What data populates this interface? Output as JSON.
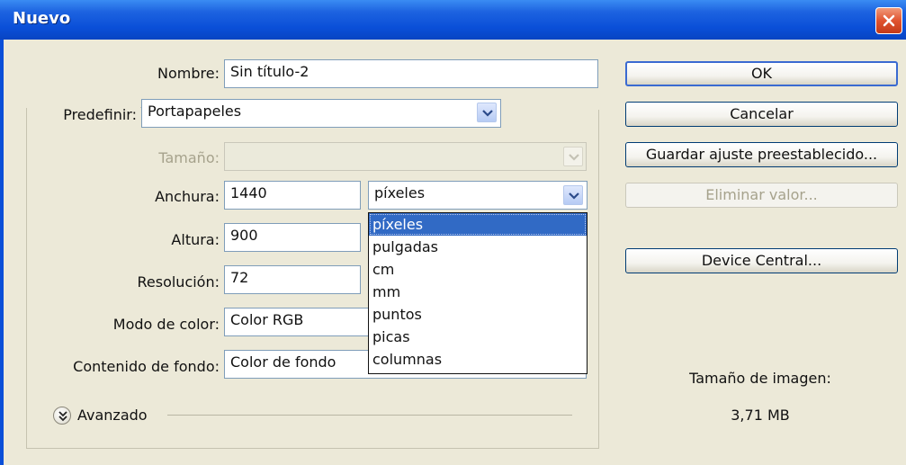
{
  "window": {
    "title": "Nuevo"
  },
  "form": {
    "name_label": "Nombre:",
    "name_value": "Sin título-2",
    "preset_label": "Predefinir:",
    "preset_value": "Portapapeles",
    "size_label": "Tamaño:",
    "size_value": "",
    "width_label": "Anchura:",
    "width_value": "1440",
    "width_unit": "píxeles",
    "height_label": "Altura:",
    "height_value": "900",
    "resolution_label": "Resolución:",
    "resolution_value": "72",
    "color_mode_label": "Modo de color:",
    "color_mode_value": "Color RGB",
    "background_label": "Contenido de fondo:",
    "background_value": "Color de fondo",
    "advanced_label": "Avanzado"
  },
  "unit_dropdown": {
    "options": [
      "píxeles",
      "pulgadas",
      "cm",
      "mm",
      "puntos",
      "picas",
      "columnas"
    ],
    "selected": "píxeles"
  },
  "buttons": {
    "ok": "OK",
    "cancel": "Cancelar",
    "save_preset": "Guardar ajuste preestablecido...",
    "delete_preset": "Eliminar valor...",
    "device_central": "Device Central..."
  },
  "image_size": {
    "label": "Tamaño de imagen:",
    "value": "3,71 MB"
  },
  "colors": {
    "titlebar": "#0a4fd8",
    "dialog_bg": "#ece9d8",
    "selection": "#316ac5",
    "close_button": "#e0532f"
  },
  "icons": {
    "close": "close-icon",
    "combo_arrow": "chevron-down-icon",
    "advanced": "double-chevron-down-icon"
  }
}
